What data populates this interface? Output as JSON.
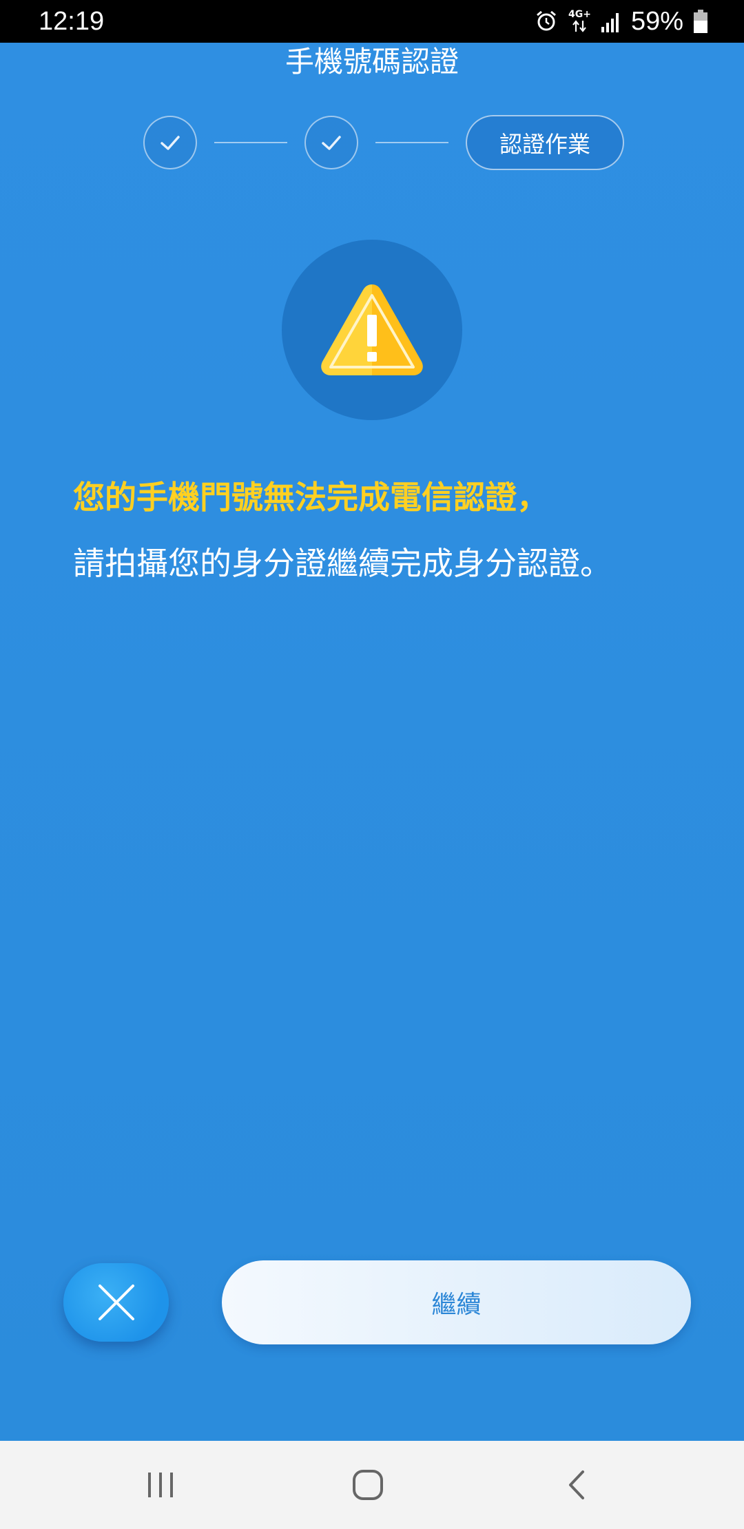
{
  "status_bar": {
    "time": "12:19",
    "network": "4G+",
    "battery": "59%"
  },
  "header": {
    "title": "手機號碼認證"
  },
  "stepper": {
    "steps": [
      {
        "state": "done",
        "icon": "check-icon"
      },
      {
        "state": "done",
        "icon": "check-icon"
      },
      {
        "state": "current",
        "label": "認證作業"
      }
    ]
  },
  "message": {
    "icon": "warning-icon",
    "warning": "您的手機門號無法完成電信認證，",
    "body": "請拍攝您的身分證繼續完成身分認證。"
  },
  "actions": {
    "close_icon": "close-icon",
    "continue_label": "繼續"
  },
  "navbar": {
    "items": [
      "recent-apps-icon",
      "home-icon",
      "back-icon"
    ]
  },
  "colors": {
    "background": "#2b8fe0",
    "warning_text": "#ffd021",
    "continue_text": "#2b86d6"
  }
}
